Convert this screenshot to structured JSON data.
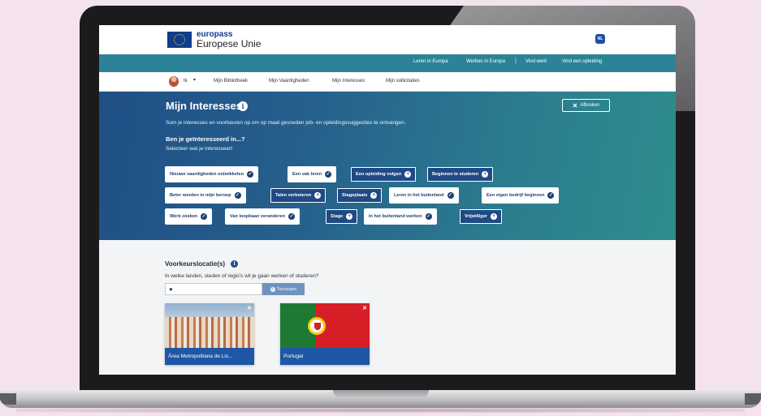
{
  "header": {
    "brand": "europass",
    "brand_sub": "Europese Unie",
    "language": "NL"
  },
  "top_nav": {
    "links": [
      "Leren in Europa",
      "Werken in Europa",
      "Vind werk",
      "Vind een opleiding"
    ]
  },
  "user_nav": {
    "user": "Ik",
    "tabs": [
      "Mijn Bibliotheek",
      "Mijn Vaardigheden",
      "Mijn Interesses",
      "Mijn sollicitaties"
    ]
  },
  "hero": {
    "title": "Mijn Interesses",
    "close_label": "Afbreken",
    "description": "Som je interesses en voorkeuren op om op maat gesneden job- en opleidingssuggesties te ontvangen.",
    "question": "Ben je geïnteresseerd in...?",
    "hint": "Selecteer wat je interesseert",
    "chips": [
      {
        "label": "Nieuwe vaardigheden ontwikkelen",
        "selected": true
      },
      {
        "label": "Een vak leren",
        "selected": true
      },
      {
        "label": "Een opleiding volgen",
        "selected": false
      },
      {
        "label": "Beginnen te studeren",
        "selected": false
      },
      {
        "label": "Beter worden in mijn beroep",
        "selected": true
      },
      {
        "label": "Talen verbeteren",
        "selected": false
      },
      {
        "label": "Stageplaats",
        "selected": false
      },
      {
        "label": "Leren in het buitenland",
        "selected": true
      },
      {
        "label": "Een eigen bedrijf beginnen",
        "selected": true
      },
      {
        "label": "Werk zoeken",
        "selected": true
      },
      {
        "label": "Van loopbaan veranderen",
        "selected": true
      },
      {
        "label": "Stage",
        "selected": false
      },
      {
        "label": "In het buitenland werken",
        "selected": true
      },
      {
        "label": "Vrijwilliger",
        "selected": false
      }
    ]
  },
  "location": {
    "title": "Voorkeurslocatie(s)",
    "subtitle": "In welke landen, steden of regio's wil je gaan werken of studeren?",
    "input_value": "",
    "input_placeholder": "",
    "add_label": "Toevoegen",
    "cards": [
      {
        "label": "Área Metropolitana de Lis..."
      },
      {
        "label": "Portugal"
      }
    ]
  },
  "colors": {
    "accent_teal": "#2c8398",
    "brand_blue": "#0f3c8f",
    "card_blue": "#1f56a6"
  }
}
